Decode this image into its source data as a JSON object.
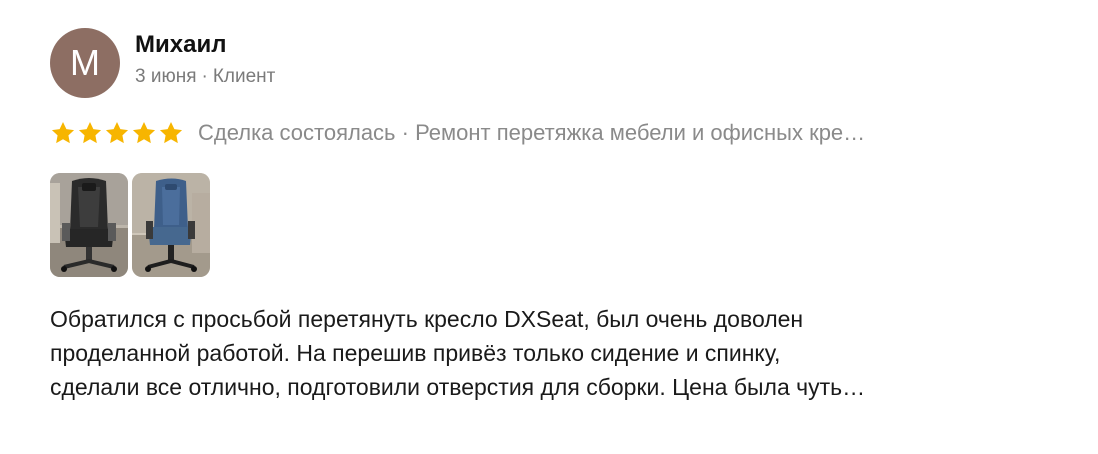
{
  "author": {
    "initial": "M",
    "name": "Михаил",
    "date": "3 июня",
    "separator": "·",
    "role": "Клиент",
    "avatar_color": "#8d6e63"
  },
  "rating": {
    "stars": 5,
    "max_stars": 5,
    "star_color": "#f7b500",
    "deal_text": "Сделка состоялась · Ремонт перетяжка мебели и офисных кре…"
  },
  "photos": [
    {
      "icon": "black-gaming-chair-photo"
    },
    {
      "icon": "blue-gaming-chair-photo"
    }
  ],
  "review": {
    "lines": [
      "Обратился с просьбой перетянуть кресло DXSeat, был очень доволен",
      "проделанной работой. На перешив привёз только сидение и спинку,",
      "сделали все отлично, подготовили отверстия для сборки. Цена была чуть…"
    ]
  }
}
